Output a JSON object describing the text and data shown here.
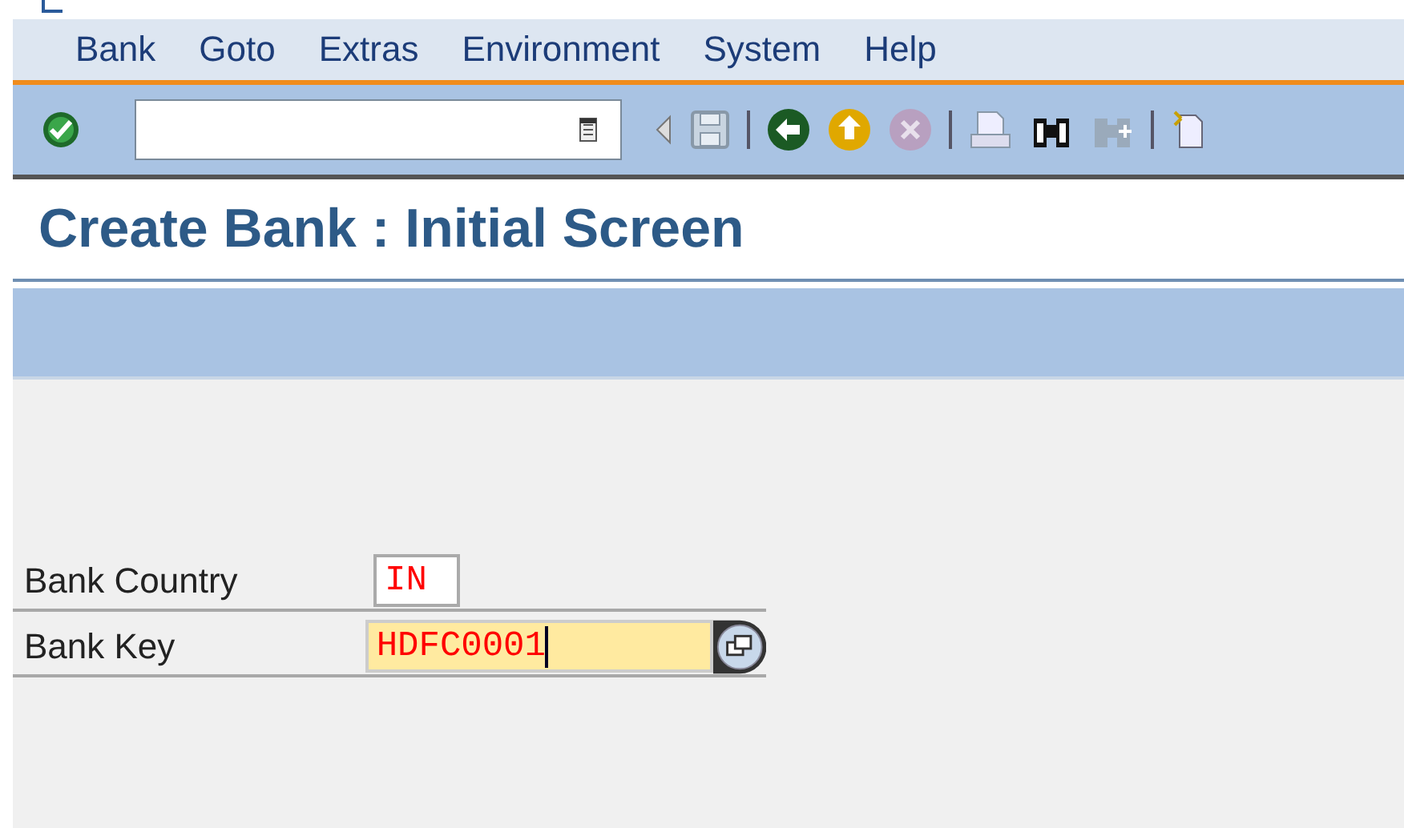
{
  "menu": [
    "Bank",
    "Goto",
    "Extras",
    "Environment",
    "System",
    "Help"
  ],
  "title": "Create Bank : Initial Screen",
  "fields": [
    {
      "label": "Bank Country",
      "value": "IN",
      "focused": false,
      "search_help": false
    },
    {
      "label": "Bank Key",
      "value": "HDFC0001",
      "focused": true,
      "search_help": true
    }
  ]
}
